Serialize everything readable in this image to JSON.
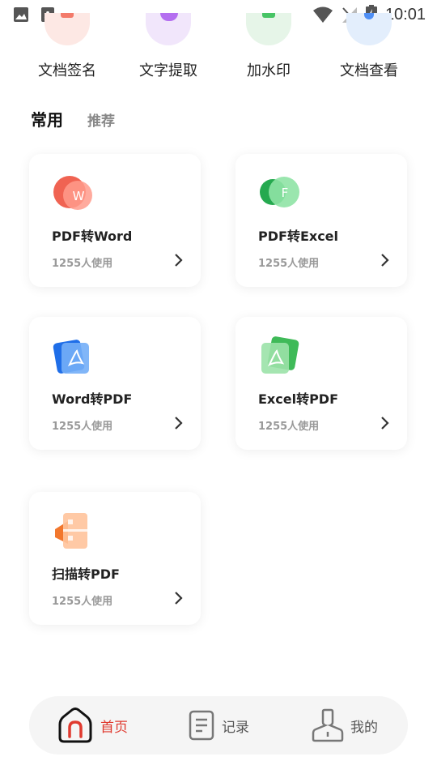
{
  "status_bar": {
    "time": "10:01"
  },
  "tools": [
    {
      "label": "文档签名",
      "color": "#fde8e4"
    },
    {
      "label": "文字提取",
      "color": "#f1e6fb"
    },
    {
      "label": "加水印",
      "color": "#e6f5e8"
    },
    {
      "label": "文档查看",
      "color": "#e3eefc"
    }
  ],
  "section_tabs": {
    "active": "常用",
    "inactive": "推荐"
  },
  "cards": [
    {
      "title": "PDF转Word",
      "usage": "1255人使用",
      "icon": "word-icon",
      "color": "#f15a4a"
    },
    {
      "title": "PDF转Excel",
      "usage": "1255人使用",
      "icon": "excel-icon",
      "color": "#2fb55b"
    },
    {
      "title": "Word转PDF",
      "usage": "1255人使用",
      "icon": "pdf-blue-icon",
      "color": "#2e7cf0"
    },
    {
      "title": "Excel转PDF",
      "usage": "1255人使用",
      "icon": "pdf-green-icon",
      "color": "#4bbf5e"
    },
    {
      "title": "扫描转PDF",
      "usage": "1255人使用",
      "icon": "scan-icon",
      "color": "#f5883a"
    }
  ],
  "bottom_nav": {
    "home": "首页",
    "records": "记录",
    "mine": "我的",
    "active_color": "#e03a2f"
  }
}
